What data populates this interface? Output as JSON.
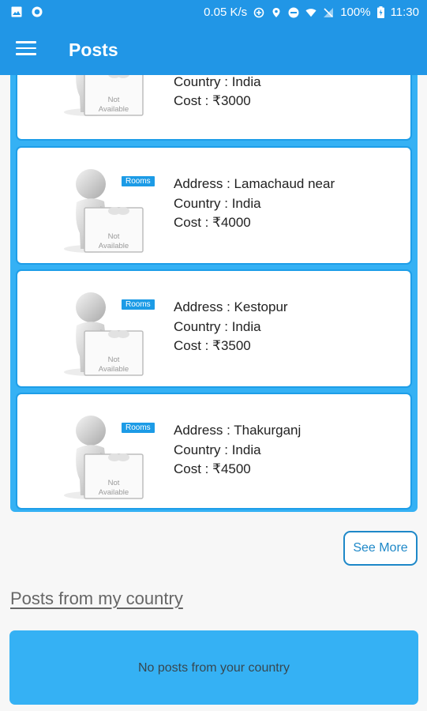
{
  "status_bar": {
    "network_speed": "0.05 K/s",
    "battery": "100%",
    "time": "11:30",
    "left_icons": [
      "gallery-icon",
      "circle-notification-icon"
    ],
    "right_icons": [
      "data-saver-icon",
      "location-icon",
      "do-not-disturb-icon",
      "wifi-icon",
      "no-signal-icon",
      "battery-charging-icon"
    ]
  },
  "app_bar": {
    "title": "Posts",
    "menu_icon": "hamburger-menu-icon"
  },
  "posts": [
    {
      "address": "",
      "country": "Country : India",
      "cost": "Cost : ₹3000",
      "tag": "",
      "image_text": [
        "Not",
        "Available"
      ]
    },
    {
      "address": "Address : Lamachaud near",
      "country": "Country : India",
      "cost": "Cost : ₹4000",
      "tag": "Rooms",
      "image_text": [
        "Not",
        "Available"
      ]
    },
    {
      "address": "Address : Kestopur",
      "country": "Country : India",
      "cost": "Cost : ₹3500",
      "tag": "Rooms",
      "image_text": [
        "Not",
        "Available"
      ]
    },
    {
      "address": "Address : Thakurganj",
      "country": "Country : India",
      "cost": "Cost : ₹4500",
      "tag": "Rooms",
      "image_text": [
        "Not",
        "Available"
      ]
    }
  ],
  "see_more": "See More",
  "country_section": {
    "title": "Posts from my country",
    "empty_message": "No posts from your country"
  },
  "colors": {
    "primary": "#2196e6",
    "panel": "#35b1f4",
    "card_border": "#1e9ee8",
    "tag": "#1c9be6"
  }
}
